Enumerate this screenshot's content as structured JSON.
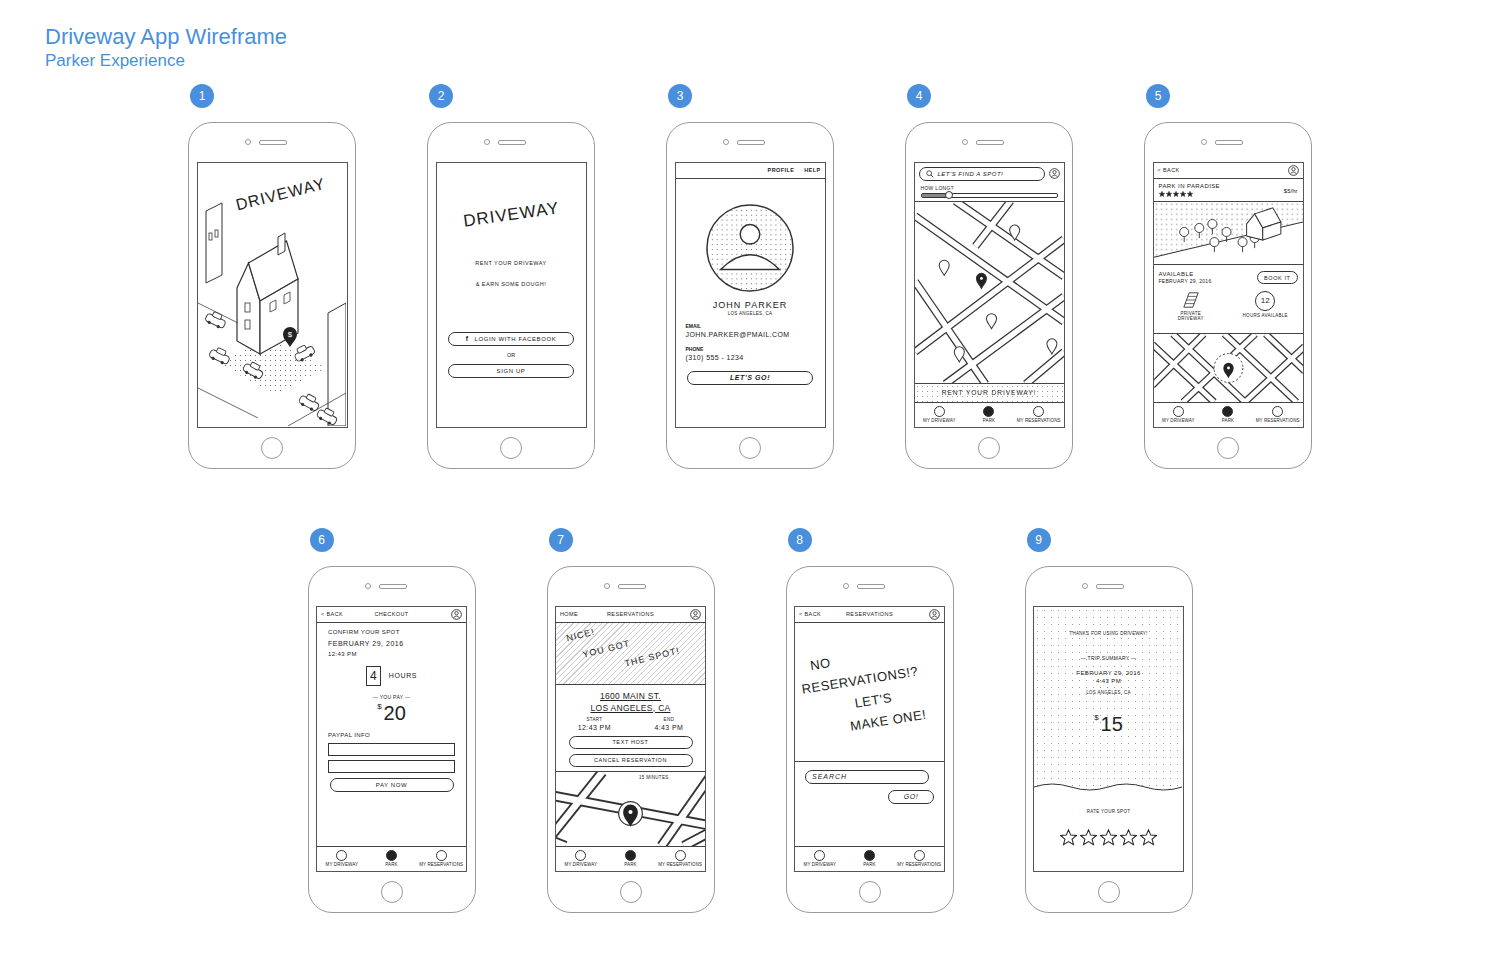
{
  "header": {
    "title": "Driveway App Wireframe",
    "subtitle": "Parker Experience"
  },
  "screens": [
    {
      "badge": "1",
      "kind": "splash",
      "logo": "DRIVEWAY",
      "pin_symbol": "$"
    },
    {
      "badge": "2",
      "kind": "login",
      "logo": "DRIVEWAY",
      "tagline": [
        "RENT YOUR DRIVEWAY",
        "& EARN SOME DOUGH!"
      ],
      "facebook_button": {
        "icon": "f",
        "label": "LOGIN WITH FACEBOOK"
      },
      "separator": "OR",
      "signup_button": "SIGN UP"
    },
    {
      "badge": "3",
      "kind": "profile",
      "nav": [
        "PROFILE",
        "HELP"
      ],
      "name": "JOHN PARKER",
      "location": "LOS ANGELES, CA",
      "fields": [
        {
          "label": "EMAIL",
          "value": "JOHN.PARKER@PMAIL.COM"
        },
        {
          "label": "PHONE",
          "value": "(310) 555 - 1234"
        }
      ],
      "button": "LET'S GO!"
    },
    {
      "badge": "4",
      "kind": "map",
      "search": {
        "placeholder": "LET'S FIND A SPOT!"
      },
      "duration": {
        "label": "HOW LONG?",
        "level": 0.2
      },
      "pins": [
        {
          "selected": false
        },
        {
          "selected": false
        },
        {
          "selected": true
        },
        {
          "selected": false
        },
        {
          "selected": false
        },
        {
          "selected": false
        }
      ],
      "banner": "RENT YOUR DRIVEWAY!",
      "tabs": [
        {
          "label": "MY DRIVEWAY",
          "selected": false
        },
        {
          "label": "PARK",
          "selected": true
        },
        {
          "label": "MY RESERVATIONS",
          "selected": false
        }
      ]
    },
    {
      "badge": "5",
      "kind": "spot",
      "back": "< BACK",
      "title": "PARK IN PARADISE",
      "stars": 5,
      "price": "$5/hr",
      "availability": {
        "label": "AVAILABLE",
        "date": "FEBRUARY 29, 2016"
      },
      "book_button": "BOOK IT",
      "driveway_label": "PRIVATE DRIVEWAY",
      "hours": {
        "value": "12",
        "label": "HOURS AVAILABLE"
      },
      "tabs": [
        {
          "label": "MY DRIVEWAY",
          "selected": false
        },
        {
          "label": "PARK",
          "selected": true
        },
        {
          "label": "MY RESERVATIONS",
          "selected": false
        }
      ]
    },
    {
      "badge": "6",
      "kind": "checkout",
      "back": "< BACK",
      "title": "CHECKOUT",
      "prompt": "CONFIRM YOUR SPOT",
      "date": "FEBRUARY 29, 2016",
      "time": "12:43 PM",
      "hours": {
        "value": "4",
        "label": "HOURS"
      },
      "pay_label": "— YOU PAY —",
      "currency": "$",
      "amount": "20",
      "paypal": {
        "label": "PAYPAL INFO",
        "fields": [
          {
            "value": ""
          },
          {
            "value": ""
          }
        ]
      },
      "button": "PAY NOW",
      "tabs": [
        {
          "label": "MY DRIVEWAY",
          "selected": false
        },
        {
          "label": "PARK",
          "selected": true
        },
        {
          "label": "MY RESERVATIONS",
          "selected": false
        }
      ]
    },
    {
      "badge": "7",
      "kind": "reservation",
      "home": "HOME",
      "title": "RESERVATIONS",
      "banner": [
        "NICE!",
        "YOU GOT",
        "THE SPOT!"
      ],
      "address": [
        "1600 MAIN ST.",
        "LOS ANGELES, CA"
      ],
      "times": [
        {
          "label": "START",
          "value": "12:43 PM"
        },
        {
          "label": "END",
          "value": "4:43 PM"
        }
      ],
      "buttons": [
        "TEXT HOST",
        "CANCEL RESERVATION"
      ],
      "eta": "15 MINUTES",
      "tabs": [
        {
          "label": "MY DRIVEWAY",
          "selected": false
        },
        {
          "label": "PARK",
          "selected": true
        },
        {
          "label": "MY RESERVATIONS",
          "selected": false
        }
      ]
    },
    {
      "badge": "8",
      "kind": "empty",
      "back": "< BACK",
      "title": "RESERVATIONS",
      "message": [
        "NO",
        "RESERVATIONS!?",
        "LET'S",
        "MAKE ONE!"
      ],
      "search": {
        "placeholder": "SEARCH"
      },
      "button": "GO!",
      "tabs": [
        {
          "label": "MY DRIVEWAY",
          "selected": false
        },
        {
          "label": "PARK",
          "selected": true
        },
        {
          "label": "MY RESERVATIONS",
          "selected": false
        }
      ]
    },
    {
      "badge": "9",
      "kind": "summary",
      "thanks": "THANKS FOR USING DRIVEWAY!",
      "summary_title": "— TRIP SUMMARY —",
      "date": "FEBRUARY 29, 2016",
      "time": "4:43 PM",
      "location": "LOS ANGELES, CA",
      "currency": "$",
      "amount": "15",
      "rate_label": "RATE YOUR SPOT",
      "stars": 0
    }
  ]
}
